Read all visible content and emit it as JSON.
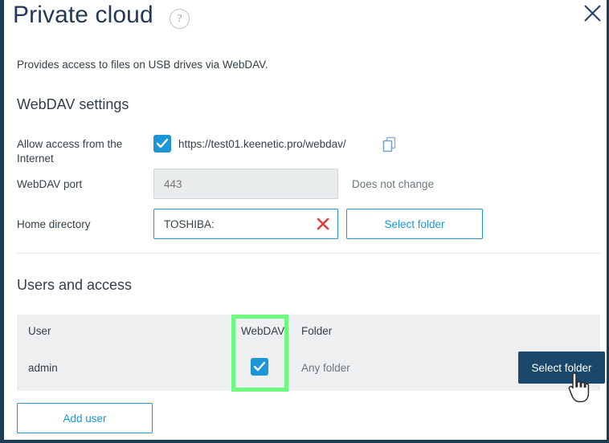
{
  "window": {
    "title": "Private cloud",
    "help_icon": "question-mark-circle-icon",
    "close_icon": "close-icon",
    "description": "Provides access to files on USB drives via WebDAV."
  },
  "webdav_settings": {
    "heading": "WebDAV settings",
    "allow_access": {
      "label": "Allow access from the Internet",
      "checked": true,
      "url": "https://test01.keenetic.pro/webdav/",
      "copy_icon": "copy-icon"
    },
    "port": {
      "label": "WebDAV port",
      "value": "443",
      "placeholder": "443",
      "disabled": true,
      "hint": "Does not change"
    },
    "home_directory": {
      "label": "Home directory",
      "value": "TOSHIBA:",
      "clear_icon": "close-x-icon",
      "select_folder_label": "Select folder"
    }
  },
  "users_and_access": {
    "heading": "Users and access",
    "columns": [
      "User",
      "WebDAV",
      "Folder"
    ],
    "rows": [
      {
        "user": "admin",
        "webdav": true,
        "folder": "Any folder",
        "action_label": "Select folder"
      }
    ],
    "add_user_label": "Add user"
  },
  "colors": {
    "title": "#24395a",
    "accent_blue": "#1b96d6",
    "primary_navy": "#1b476b",
    "panel_border": "#1d3c55",
    "table_bg": "#edeff0",
    "highlight_green": "#6cf97f",
    "clear_red": "#e53b40",
    "muted_text": "#6b7780"
  }
}
